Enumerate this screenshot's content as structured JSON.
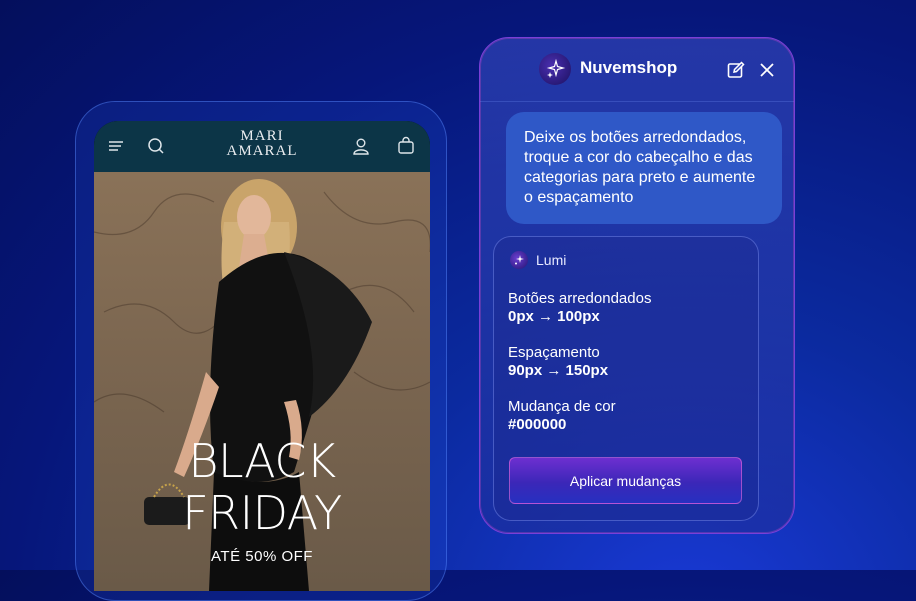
{
  "phone": {
    "brand_line1": "MARI",
    "brand_line2": "AMARAL",
    "hero_title_line1": "BLACK",
    "hero_title_line2": "FRIDAY",
    "hero_subtitle": "ATÉ 50% OFF",
    "icons": [
      "menu-icon",
      "search-icon",
      "user-icon",
      "bag-icon"
    ]
  },
  "chat": {
    "title": "Nuvemshop",
    "icons": [
      "sparkle-icon",
      "edit-icon",
      "close-icon"
    ],
    "user_message": "Deixe os botões arredondados, troque a cor do cabeçalho e das categorias para preto e aumente o espaçamento",
    "assistant": {
      "name": "Lumi",
      "changes": [
        {
          "label": "Botões arredondados",
          "value": "0px → 100px"
        },
        {
          "label": "Espaçamento",
          "value": "90px → 150px"
        },
        {
          "label": "Mudança de cor",
          "value": "#000000"
        }
      ],
      "apply_label": "Aplicar mudanças"
    }
  },
  "colors": {
    "background": "#0b2a9f",
    "phone_header": "#0c3547",
    "accent": "#6d2fd0"
  }
}
